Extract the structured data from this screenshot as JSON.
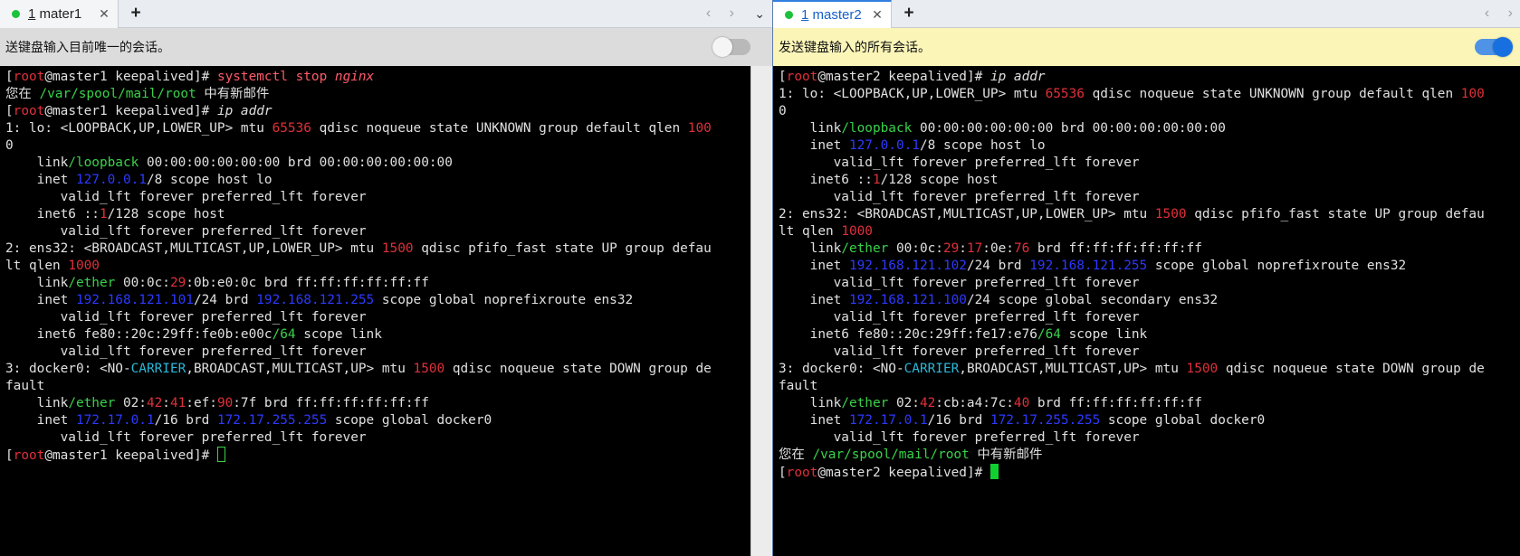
{
  "pane1": {
    "tab": {
      "number": "1",
      "title": " mater1",
      "close": "✕"
    },
    "new_tab": "+",
    "nav": "‹ ›",
    "dropdown": "⌄",
    "notice": "送键盘输入目前唯一的会话。",
    "broadcast_toggle": false,
    "lines": [
      [
        [
          "[",
          ""
        ],
        [
          "root",
          "red"
        ],
        [
          "@master1 keepalived]# ",
          ""
        ],
        [
          "systemctl stop ",
          "cmd"
        ],
        [
          "nginx",
          "cmdi"
        ]
      ],
      [
        [
          "您在 ",
          ""
        ],
        [
          "/var/spool/mail/root",
          "grn"
        ],
        [
          " 中有新邮件",
          ""
        ]
      ],
      [
        [
          "[",
          ""
        ],
        [
          "root",
          "red"
        ],
        [
          "@master1 keepalived]# ",
          ""
        ],
        [
          "ip addr",
          "ital"
        ]
      ],
      [
        [
          "1: lo: <LOOPBACK,UP,LOWER_UP> mtu ",
          ""
        ],
        [
          "65536",
          "red"
        ],
        [
          " qdisc noqueue state UNKNOWN group default qlen ",
          ""
        ],
        [
          "100",
          "red"
        ]
      ],
      [
        [
          "0",
          ""
        ]
      ],
      [
        [
          "    link",
          ""
        ],
        [
          "/loopback",
          "grn"
        ],
        [
          " 00:00:00:00:00:00 brd 00:00:00:00:00:00",
          ""
        ]
      ],
      [
        [
          "    inet ",
          ""
        ],
        [
          "127.0.0.1",
          "blu"
        ],
        [
          "/8 scope host lo",
          ""
        ]
      ],
      [
        [
          "       valid_lft forever preferred_lft forever",
          ""
        ]
      ],
      [
        [
          "    inet6 ::",
          ""
        ],
        [
          "1",
          "red"
        ],
        [
          "/128 scope host",
          ""
        ]
      ],
      [
        [
          "       valid_lft forever preferred_lft forever",
          ""
        ]
      ],
      [
        [
          "2: ens32: <BROADCAST,MULTICAST,UP,LOWER_UP> mtu ",
          ""
        ],
        [
          "1500",
          "red"
        ],
        [
          " qdisc pfifo_fast state UP group defau",
          ""
        ]
      ],
      [
        [
          "lt qlen ",
          ""
        ],
        [
          "1000",
          "red"
        ]
      ],
      [
        [
          "    link",
          ""
        ],
        [
          "/ether",
          "grn"
        ],
        [
          " 00:0c:",
          ""
        ],
        [
          "29",
          "red"
        ],
        [
          ":0b:e0:0c brd ff:ff:ff:ff:ff:ff",
          ""
        ]
      ],
      [
        [
          "    inet ",
          ""
        ],
        [
          "192.168.121.101",
          "blu"
        ],
        [
          "/24 brd ",
          ""
        ],
        [
          "192.168.121.255",
          "blu"
        ],
        [
          " scope global noprefixroute ens32",
          ""
        ]
      ],
      [
        [
          "       valid_lft forever preferred_lft forever",
          ""
        ]
      ],
      [
        [
          "    inet6 fe80::20c:29ff:fe0b:e00c",
          ""
        ],
        [
          "/64",
          "grn"
        ],
        [
          " scope link",
          ""
        ]
      ],
      [
        [
          "       valid_lft forever preferred_lft forever",
          ""
        ]
      ],
      [
        [
          "3: docker0: <NO-",
          ""
        ],
        [
          "CARRIER",
          "cyn"
        ],
        [
          ",BROADCAST,MULTICAST,UP> mtu ",
          ""
        ],
        [
          "1500",
          "red"
        ],
        [
          " qdisc noqueue state DOWN group de",
          ""
        ]
      ],
      [
        [
          "fault",
          ""
        ]
      ],
      [
        [
          "    link",
          ""
        ],
        [
          "/ether",
          "grn"
        ],
        [
          " 02:",
          ""
        ],
        [
          "42",
          "red"
        ],
        [
          ":",
          ""
        ],
        [
          "41",
          "red"
        ],
        [
          ":ef:",
          ""
        ],
        [
          "90",
          "red"
        ],
        [
          ":7f brd ff:ff:ff:ff:ff:ff",
          ""
        ]
      ],
      [
        [
          "    inet ",
          ""
        ],
        [
          "172.17.0.1",
          "blu"
        ],
        [
          "/16 brd ",
          ""
        ],
        [
          "172.17.255.255",
          "blu"
        ],
        [
          " scope global docker0",
          ""
        ]
      ],
      [
        [
          "       valid_lft forever preferred_lft forever",
          ""
        ]
      ],
      [
        [
          "[",
          ""
        ],
        [
          "root",
          "red"
        ],
        [
          "@master1 keepalived]# ",
          ""
        ],
        [
          "",
          "cursor-outline"
        ]
      ]
    ]
  },
  "pane2": {
    "tab": {
      "number": "1",
      "title": " master2",
      "close": "✕"
    },
    "new_tab": "+",
    "nav": "‹ ›",
    "notice": "发送键盘输入的所有会话。",
    "broadcast_toggle": true,
    "lines": [
      [
        [
          "[",
          ""
        ],
        [
          "root",
          "red"
        ],
        [
          "@master2 keepalived]# ",
          ""
        ],
        [
          "ip addr",
          "ital"
        ]
      ],
      [
        [
          "1: lo: <LOOPBACK,UP,LOWER_UP> mtu ",
          ""
        ],
        [
          "65536",
          "red"
        ],
        [
          " qdisc noqueue state UNKNOWN group default qlen ",
          ""
        ],
        [
          "100",
          "red"
        ]
      ],
      [
        [
          "0",
          ""
        ]
      ],
      [
        [
          "    link",
          ""
        ],
        [
          "/loopback",
          "grn"
        ],
        [
          " 00:00:00:00:00:00 brd 00:00:00:00:00:00",
          ""
        ]
      ],
      [
        [
          "    inet ",
          ""
        ],
        [
          "127.0.0.1",
          "blu"
        ],
        [
          "/8 scope host lo",
          ""
        ]
      ],
      [
        [
          "       valid_lft forever preferred_lft forever",
          ""
        ]
      ],
      [
        [
          "    inet6 ::",
          ""
        ],
        [
          "1",
          "red"
        ],
        [
          "/128 scope host",
          ""
        ]
      ],
      [
        [
          "       valid_lft forever preferred_lft forever",
          ""
        ]
      ],
      [
        [
          "2: ens32: <BROADCAST,MULTICAST,UP,LOWER_UP> mtu ",
          ""
        ],
        [
          "1500",
          "red"
        ],
        [
          " qdisc pfifo_fast state UP group defau",
          ""
        ]
      ],
      [
        [
          "lt qlen ",
          ""
        ],
        [
          "1000",
          "red"
        ]
      ],
      [
        [
          "    link",
          ""
        ],
        [
          "/ether",
          "grn"
        ],
        [
          " 00:0c:",
          ""
        ],
        [
          "29",
          "red"
        ],
        [
          ":",
          ""
        ],
        [
          "17",
          "red"
        ],
        [
          ":0e:",
          ""
        ],
        [
          "76",
          "red"
        ],
        [
          " brd ff:ff:ff:ff:ff:ff",
          ""
        ]
      ],
      [
        [
          "    inet ",
          ""
        ],
        [
          "192.168.121.102",
          "blu"
        ],
        [
          "/24 brd ",
          ""
        ],
        [
          "192.168.121.255",
          "blu"
        ],
        [
          " scope global noprefixroute ens32",
          ""
        ]
      ],
      [
        [
          "       valid_lft forever preferred_lft forever",
          ""
        ]
      ],
      [
        [
          "    inet ",
          ""
        ],
        [
          "192.168.121.100",
          "blu"
        ],
        [
          "/24 scope global secondary ens32",
          ""
        ]
      ],
      [
        [
          "       valid_lft forever preferred_lft forever",
          ""
        ]
      ],
      [
        [
          "    inet6 fe80::20c:29ff:fe17:e76",
          ""
        ],
        [
          "/64",
          "grn"
        ],
        [
          " scope link",
          ""
        ]
      ],
      [
        [
          "       valid_lft forever preferred_lft forever",
          ""
        ]
      ],
      [
        [
          "3: docker0: <NO-",
          ""
        ],
        [
          "CARRIER",
          "cyn"
        ],
        [
          ",BROADCAST,MULTICAST,UP> mtu ",
          ""
        ],
        [
          "1500",
          "red"
        ],
        [
          " qdisc noqueue state DOWN group de",
          ""
        ]
      ],
      [
        [
          "fault",
          ""
        ]
      ],
      [
        [
          "    link",
          ""
        ],
        [
          "/ether",
          "grn"
        ],
        [
          " 02:",
          ""
        ],
        [
          "42",
          "red"
        ],
        [
          ":cb:a4:7c:",
          ""
        ],
        [
          "40",
          "red"
        ],
        [
          " brd ff:ff:ff:ff:ff:ff",
          ""
        ]
      ],
      [
        [
          "    inet ",
          ""
        ],
        [
          "172.17.0.1",
          "blu"
        ],
        [
          "/16 brd ",
          ""
        ],
        [
          "172.17.255.255",
          "blu"
        ],
        [
          " scope global docker0",
          ""
        ]
      ],
      [
        [
          "       valid_lft forever preferred_lft forever",
          ""
        ]
      ],
      [
        [
          "您在 ",
          ""
        ],
        [
          "/var/spool/mail/root",
          "grn"
        ],
        [
          " 中有新邮件",
          ""
        ]
      ],
      [
        [
          "[",
          ""
        ],
        [
          "root",
          "red"
        ],
        [
          "@master2 keepalived]# ",
          ""
        ],
        [
          "",
          "cursor-solid"
        ]
      ]
    ]
  }
}
